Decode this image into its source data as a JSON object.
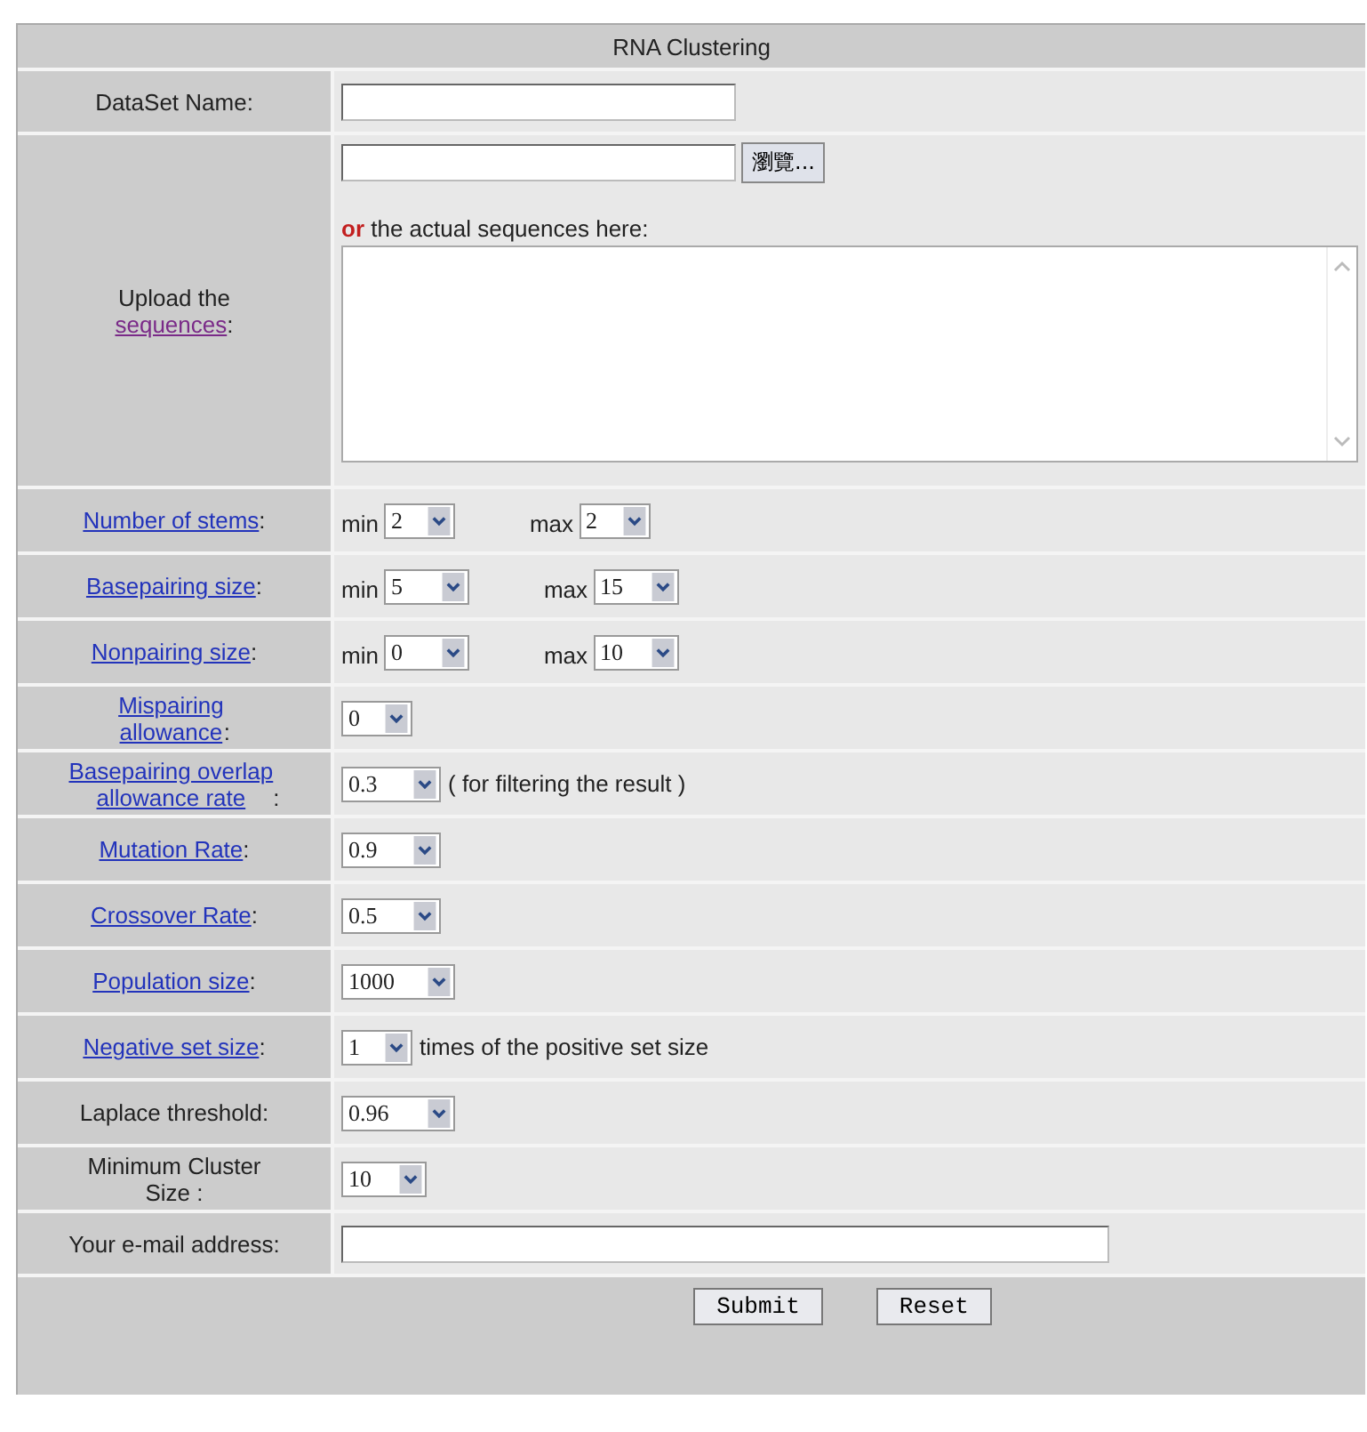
{
  "title": "RNA Clustering",
  "rows": [
    {
      "kind": "text",
      "label": {
        "text": "DataSet Name:"
      }
    },
    {
      "kind": "upload",
      "label": {
        "text": "Upload the",
        "link": "sequences",
        "suffix": ":",
        "visited": true
      },
      "browse_button": "瀏覽...",
      "or_word": "or",
      "hint": " the actual sequences here:"
    },
    {
      "kind": "range",
      "label": {
        "link": "Number of stems",
        "suffix": ":",
        "visited": false
      },
      "min_label": "min",
      "min_value": "2",
      "max_label": "max",
      "max_value": "2"
    },
    {
      "kind": "range",
      "label": {
        "link": "Basepairing size",
        "suffix": ":",
        "visited": false
      },
      "min_label": "min",
      "min_value": "5",
      "max_label": "max",
      "max_value": "15"
    },
    {
      "kind": "range",
      "label": {
        "link": "Nonpairing size",
        "suffix": ":",
        "visited": false
      },
      "min_label": "min",
      "min_value": "0",
      "max_label": "max",
      "max_value": "10"
    },
    {
      "kind": "select",
      "label": {
        "link": "Mispairing\nallowance",
        "suffix": ":",
        "visited": false
      },
      "value": "0"
    },
    {
      "kind": "select",
      "label": {
        "link": "Basepairing overlap\nallowance rate",
        "suffix": ":",
        "visited": false
      },
      "value": "0.3",
      "note": "( for filtering the result )"
    },
    {
      "kind": "select",
      "label": {
        "link": "Mutation Rate",
        "suffix": ":",
        "visited": false
      },
      "value": "0.9"
    },
    {
      "kind": "select",
      "label": {
        "link": "Crossover Rate",
        "suffix": ":",
        "visited": false
      },
      "value": "0.5"
    },
    {
      "kind": "select",
      "label": {
        "link": "Population size",
        "suffix": ":",
        "visited": false
      },
      "value": "1000"
    },
    {
      "kind": "select",
      "label": {
        "link": "Negative set size",
        "suffix": ":",
        "visited": false
      },
      "value": "1",
      "note": "times of the positive set size"
    },
    {
      "kind": "select",
      "label": {
        "text": "Laplace threshold:"
      },
      "value": "0.96"
    },
    {
      "kind": "select",
      "label": {
        "text": "Minimum Cluster\nSize :"
      },
      "value": "10"
    },
    {
      "kind": "email",
      "label": {
        "text": "Your e-mail address:"
      }
    }
  ],
  "buttons": [
    "Submit",
    "Reset"
  ]
}
